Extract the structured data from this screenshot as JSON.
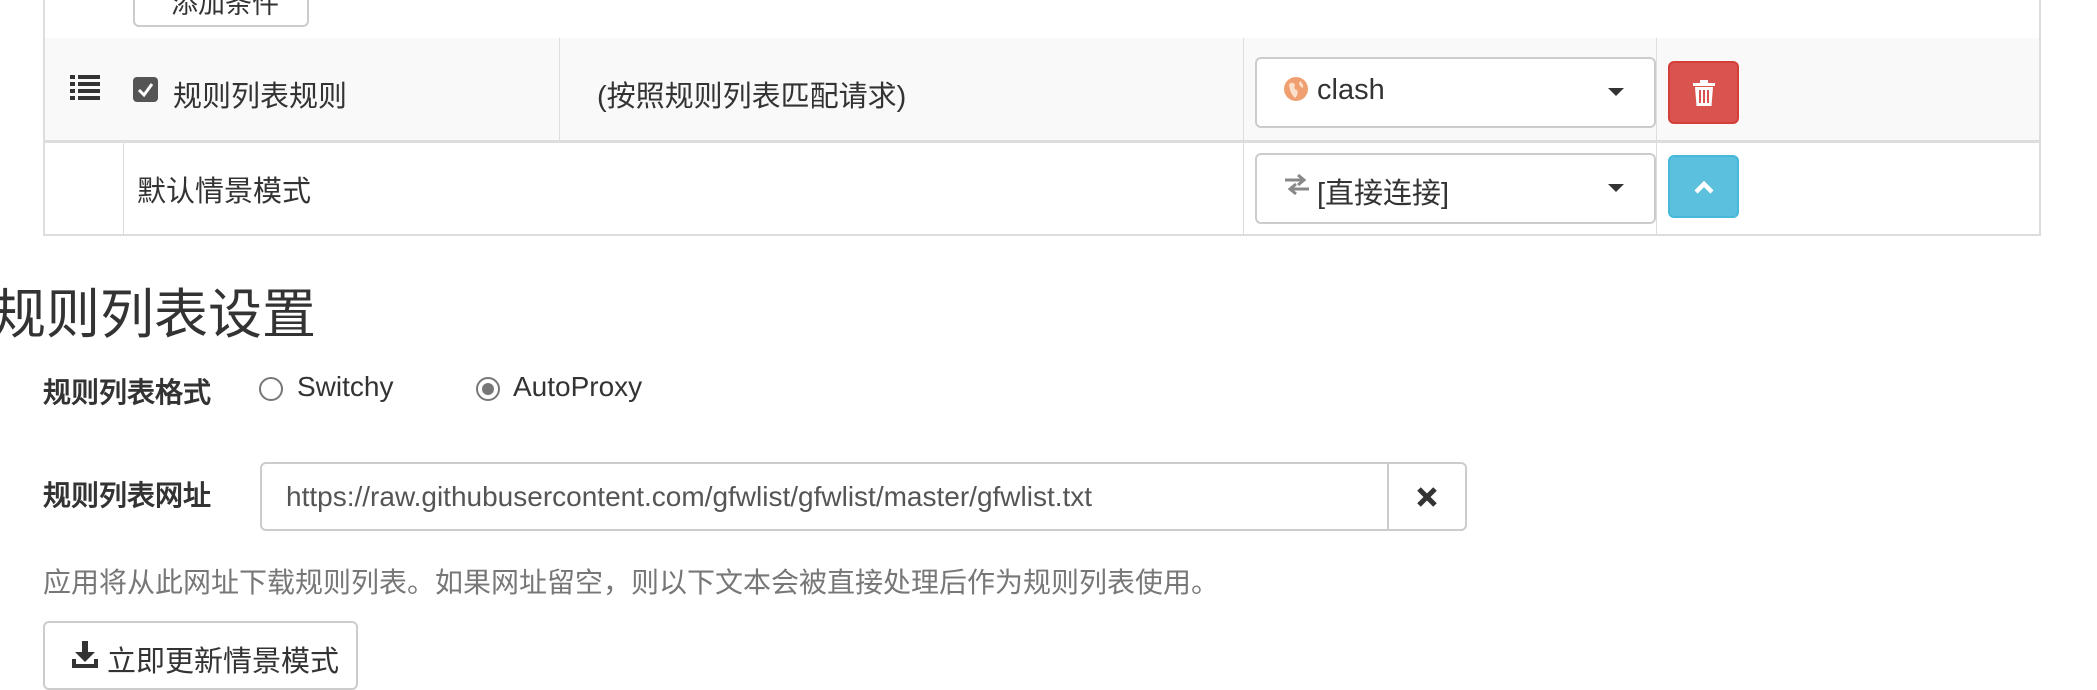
{
  "conditions_table": {
    "add_condition_label": "添加条件",
    "rule_list_row": {
      "checkbox_checked": true,
      "name": "规则列表规则",
      "description": "(按照规则列表匹配请求)",
      "profile": "clash",
      "profile_icon": "globe-icon",
      "profile_icon_color": "#f0a070",
      "delete_icon": "trash-icon"
    },
    "default_row": {
      "name": "默认情景模式",
      "profile": "[直接连接]",
      "profile_icon": "transfer-arrows-icon",
      "move_icon": "chevron-up-icon"
    }
  },
  "rule_list_settings": {
    "title": "规则列表设置",
    "format_label": "规则列表格式",
    "format_options": [
      "Switchy",
      "AutoProxy"
    ],
    "format_selected": "AutoProxy",
    "url_label": "规则列表网址",
    "url_value": "https://raw.githubusercontent.com/gfwlist/gfwlist/master/gfwlist.txt",
    "clear_icon": "close-x-icon",
    "help_text": "应用将从此网址下载规则列表。如果网址留空，则以下文本会被直接处理后作为规则列表使用。",
    "update_button": "立即更新情景模式",
    "update_icon": "download-icon"
  },
  "colors": {
    "danger": "#d9534f",
    "info": "#5bc0de",
    "border": "#dddddd",
    "muted_text": "#777777"
  }
}
